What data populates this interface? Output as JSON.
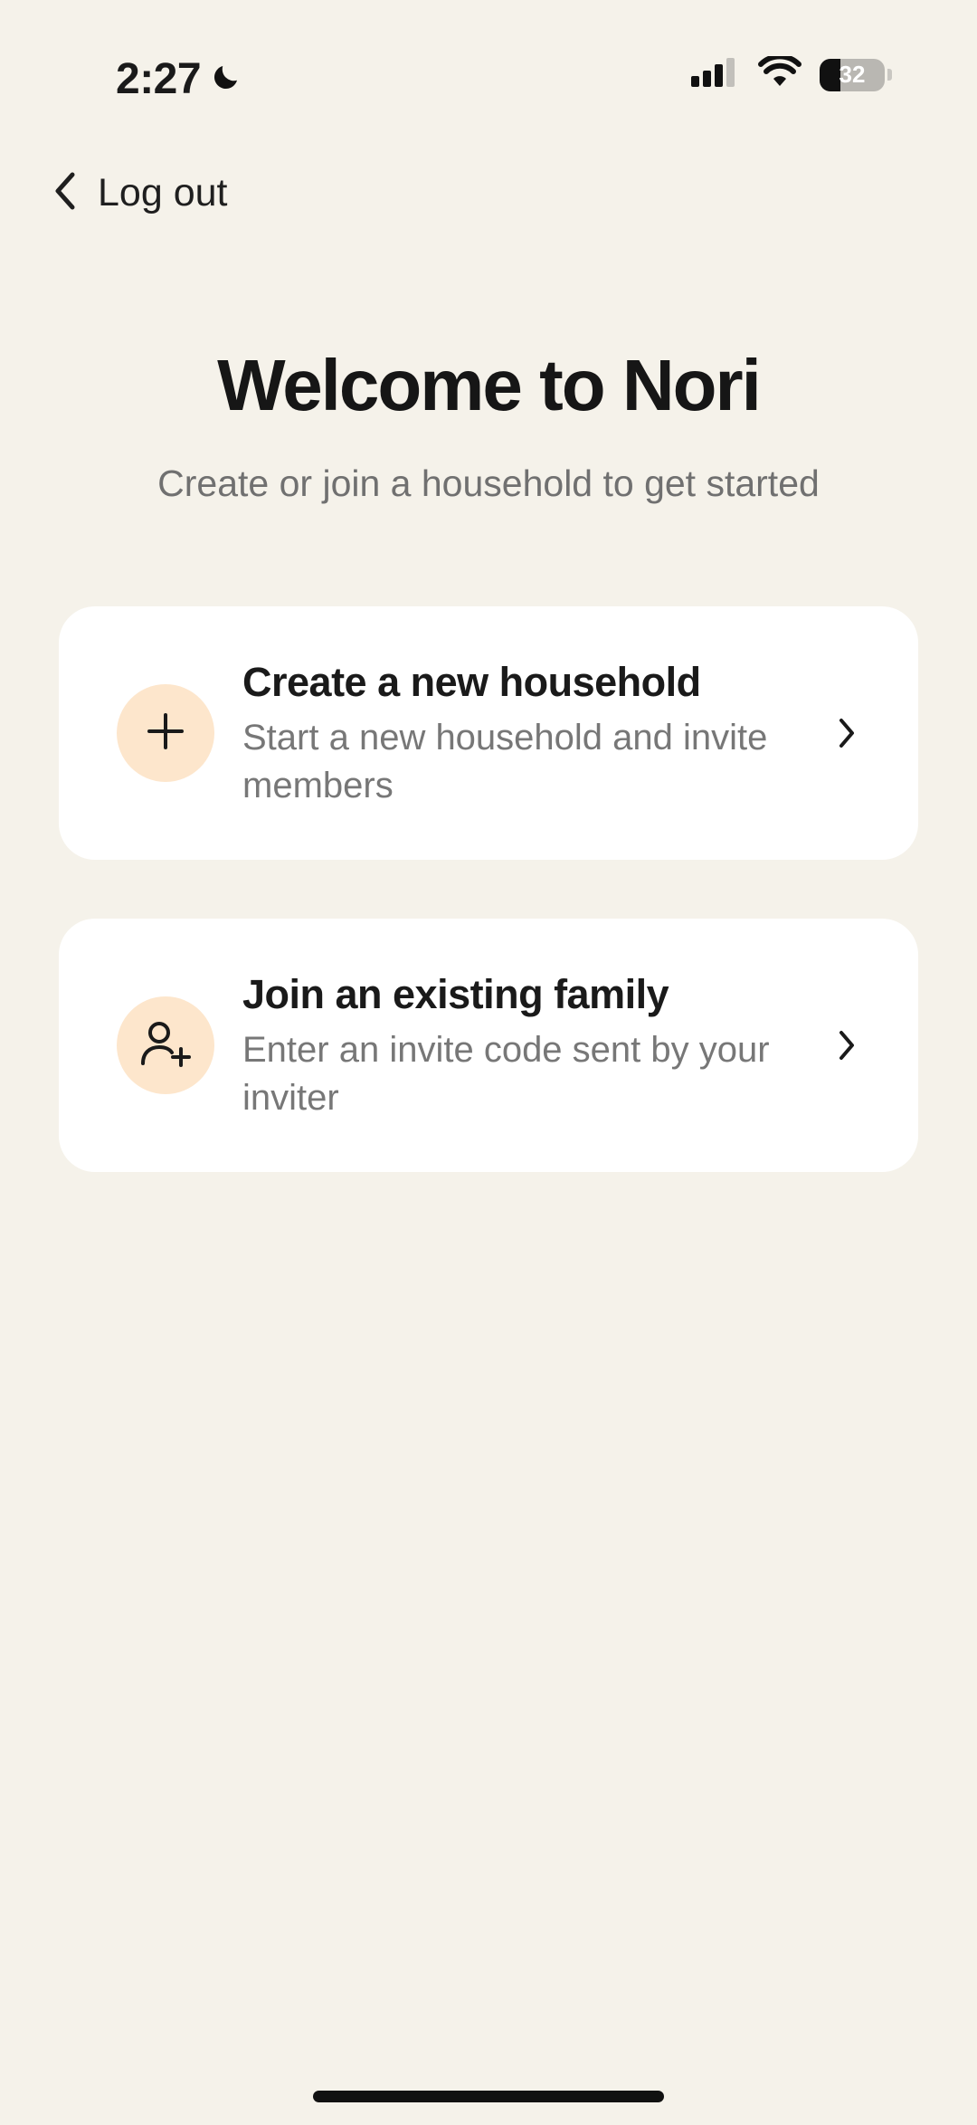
{
  "status_bar": {
    "time": "2:27",
    "battery_level": "32",
    "icons": [
      "moon-icon",
      "signal-icon",
      "wifi-icon",
      "battery-icon"
    ]
  },
  "nav": {
    "back_label": "Log out",
    "back_icon": "chevron-left-icon"
  },
  "header": {
    "title": "Welcome to Nori",
    "subtitle": "Create or join a household to get started"
  },
  "options": [
    {
      "title": "Create a new household",
      "description": "Start a new household and invite members",
      "icon": "plus-icon"
    },
    {
      "title": "Join an existing family",
      "description": "Enter an invite code sent by your inviter",
      "icon": "user-plus-icon"
    }
  ],
  "colors": {
    "background": "#f5f2ea",
    "card_background": "#ffffff",
    "icon_circle": "#fde6cc",
    "title_text": "#161616",
    "secondary_text": "#777777"
  }
}
